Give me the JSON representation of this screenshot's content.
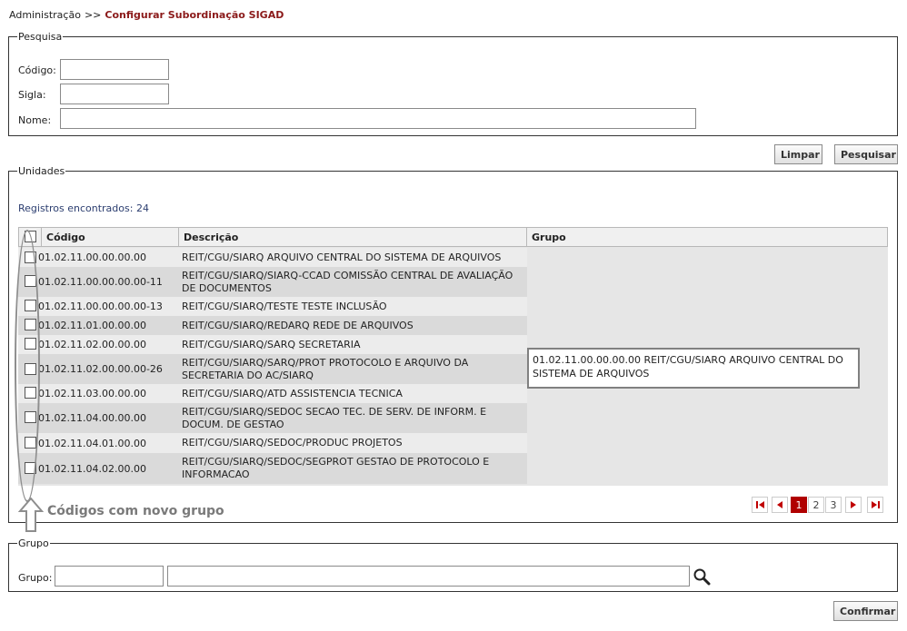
{
  "breadcrumb": {
    "parent": "Administração",
    "separator": ">>",
    "current": "Configurar Subordinação SIGAD"
  },
  "search": {
    "legend": "Pesquisa",
    "codigo_label": "Código:",
    "sigla_label": "Sigla:",
    "nome_label": "Nome:",
    "codigo_value": "",
    "sigla_value": "",
    "nome_value": ""
  },
  "buttons": {
    "limpar": "Limpar",
    "pesquisar": "Pesquisar",
    "confirmar": "Confirmar"
  },
  "units": {
    "legend": "Unidades",
    "count_text": "Registros encontrados: 24",
    "columns": [
      "Código",
      "Descrição",
      "Grupo"
    ],
    "rows": [
      {
        "codigo": "01.02.11.00.00.00.00",
        "descricao": "REIT/CGU/SIARQ ARQUIVO CENTRAL DO SISTEMA DE ARQUIVOS"
      },
      {
        "codigo": "01.02.11.00.00.00.00-11",
        "descricao": "REIT/CGU/SIARQ/SIARQ-CCAD COMISSÃO CENTRAL DE AVALIAÇÃO DE DOCUMENTOS"
      },
      {
        "codigo": "01.02.11.00.00.00.00-13",
        "descricao": "REIT/CGU/SIARQ/TESTE TESTE INCLUSÃO"
      },
      {
        "codigo": "01.02.11.01.00.00.00",
        "descricao": "REIT/CGU/SIARQ/REDARQ REDE DE ARQUIVOS"
      },
      {
        "codigo": "01.02.11.02.00.00.00",
        "descricao": "REIT/CGU/SIARQ/SARQ SECRETARIA"
      },
      {
        "codigo": "01.02.11.02.00.00.00-26",
        "descricao": "REIT/CGU/SIARQ/SARQ/PROT PROTOCOLO E ARQUIVO DA SECRETARIA DO AC/SIARQ"
      },
      {
        "codigo": "01.02.11.03.00.00.00",
        "descricao": "REIT/CGU/SIARQ/ATD ASSISTENCIA TECNICA"
      },
      {
        "codigo": "01.02.11.04.00.00.00",
        "descricao": "REIT/CGU/SIARQ/SEDOC SECAO TEC. DE SERV. DE INFORM. E DOCUM. DE GESTAO"
      },
      {
        "codigo": "01.02.11.04.01.00.00",
        "descricao": "REIT/CGU/SIARQ/SEDOC/PRODUC PROJETOS"
      },
      {
        "codigo": "01.02.11.04.02.00.00",
        "descricao": "REIT/CGU/SIARQ/SEDOC/SEGPROT GESTAO DE PROTOCOLO E INFORMACAO"
      }
    ],
    "grupo_value": "01.02.11.00.00.00.00 REIT/CGU/SIARQ ARQUIVO CENTRAL DO SISTEMA DE ARQUIVOS",
    "pages": [
      "1",
      "2",
      "3"
    ],
    "annotation": "Códigos com novo grupo"
  },
  "group": {
    "legend": "Grupo",
    "label": "Grupo:",
    "code_value": "",
    "name_value": ""
  },
  "icons": {
    "search": "magnifier-icon",
    "first": "first-page-icon",
    "prev": "prev-page-icon",
    "next": "next-page-icon",
    "last": "last-page-icon"
  }
}
